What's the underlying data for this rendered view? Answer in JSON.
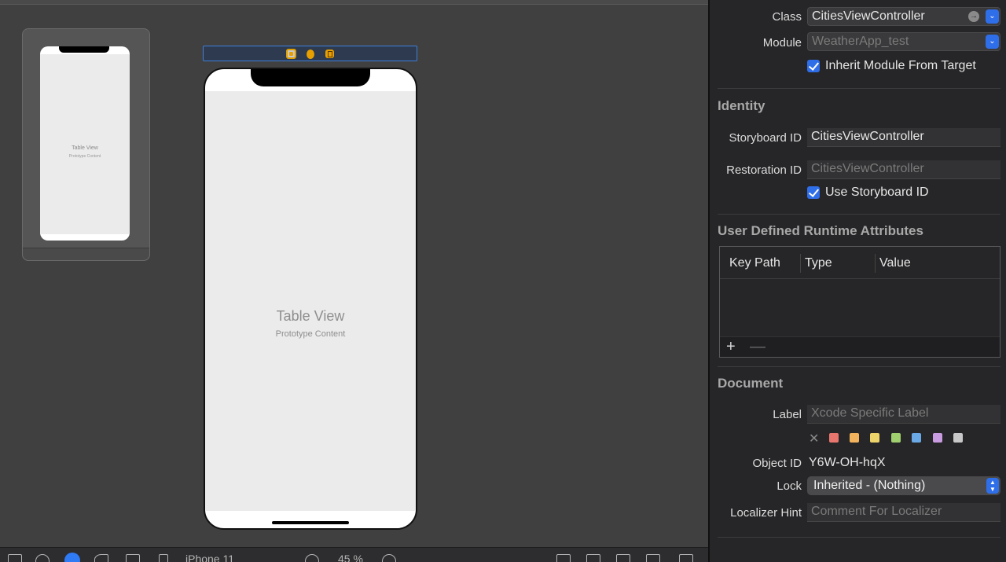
{
  "canvas": {
    "mini_title": "Table View",
    "mini_sub": "Prototype Content",
    "table_title": "Table View",
    "table_sub": "Prototype Content"
  },
  "toolbar": {
    "device": "iPhone 11",
    "zoom": "45 %"
  },
  "inspector": {
    "class_label": "Class",
    "class_value": "CitiesViewController",
    "module_label": "Module",
    "module_placeholder": "WeatherApp_test",
    "inherit_label": "Inherit Module From Target",
    "identity_section": "Identity",
    "storyboard_id_label": "Storyboard ID",
    "storyboard_id_value": "CitiesViewController",
    "restoration_id_label": "Restoration ID",
    "restoration_id_placeholder": "CitiesViewController",
    "use_storyboard_label": "Use Storyboard ID",
    "udra_section": "User Defined Runtime Attributes",
    "udra_columns": [
      "Key Path",
      "Type",
      "Value"
    ],
    "add_symbol": "+",
    "remove_symbol": "—",
    "document_section": "Document",
    "doc_label_label": "Label",
    "doc_label_placeholder": "Xcode Specific Label",
    "label_colors": [
      "#e8766f",
      "#f2b35c",
      "#ecd36a",
      "#9fcf6e",
      "#6aa8e6",
      "#c99be0",
      "#c8c8c8"
    ],
    "no_color_symbol": "✕",
    "object_id_label": "Object ID",
    "object_id_value": "Y6W-OH-hqX",
    "lock_label": "Lock",
    "lock_value": "Inherited - (Nothing)",
    "localizer_label": "Localizer Hint",
    "localizer_placeholder": "Comment For Localizer"
  }
}
